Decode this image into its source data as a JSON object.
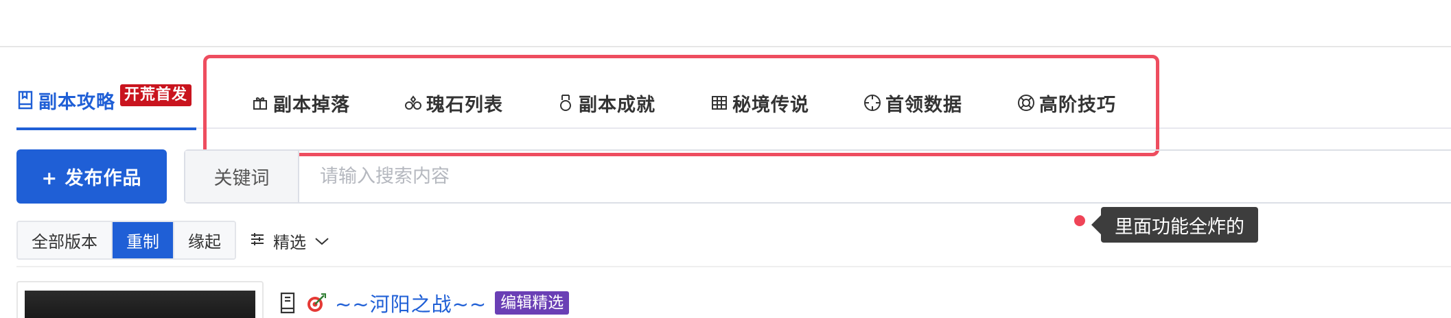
{
  "tabs": {
    "main": {
      "label": "副本攻略",
      "icon": "book-icon",
      "badge": "开荒首发"
    },
    "sub": [
      {
        "label": "副本掉落",
        "icon": "gift-icon"
      },
      {
        "label": "瑰石列表",
        "icon": "gems-icon"
      },
      {
        "label": "副本成就",
        "icon": "medal-icon"
      },
      {
        "label": "秘境传说",
        "icon": "grid-icon"
      },
      {
        "label": "首领数据",
        "icon": "crosshair-icon"
      },
      {
        "label": "高阶技巧",
        "icon": "lifebuoy-icon"
      }
    ]
  },
  "toolbar": {
    "publish_label": "+ 发布作品",
    "search_label": "关键词",
    "search_placeholder": "请输入搜索内容"
  },
  "filters": {
    "versions": [
      {
        "label": "全部版本",
        "active": false
      },
      {
        "label": "重制",
        "active": true
      },
      {
        "label": "缘起",
        "active": false
      }
    ],
    "select_label": "精选"
  },
  "annotation": {
    "tooltip": "里面功能全炸的"
  },
  "list": {
    "items": [
      {
        "title": "~~河阳之战~~",
        "badge": "编辑精选"
      }
    ]
  },
  "colors": {
    "accent": "#1f5fd6",
    "highlight": "#ee4d5f",
    "badge_hot": "#c9141e",
    "badge_editor": "#6a3fb5",
    "tooltip_bg": "#3d3d3d"
  }
}
